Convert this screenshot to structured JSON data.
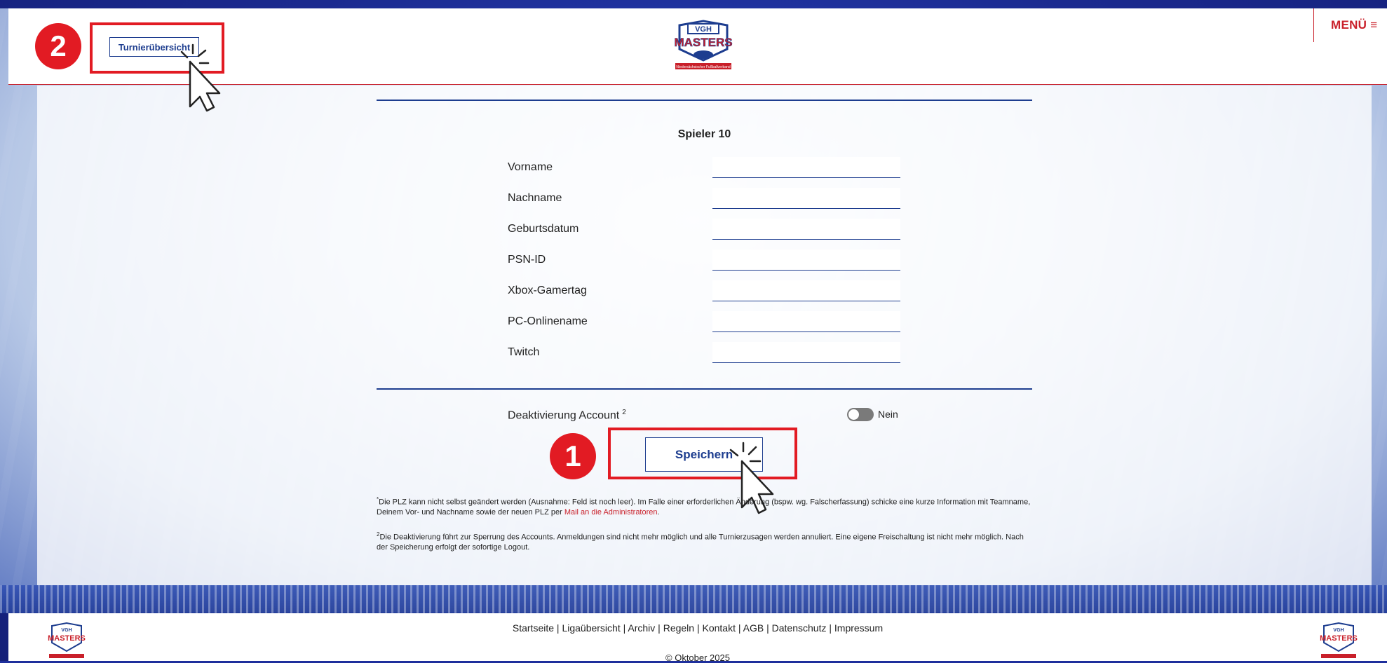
{
  "header": {
    "menu_label": "MENÜ ≡",
    "nav_button_label": "Turnierübersicht",
    "logo_text_top": "VGH",
    "logo_text_main": "MASTERS",
    "logo_subtext": "Niedersächsischer Fußballverband"
  },
  "annotations": {
    "badge_1": "1",
    "badge_2": "2"
  },
  "form": {
    "section_title": "Spieler 10",
    "fields": [
      {
        "label": "Vorname",
        "value": ""
      },
      {
        "label": "Nachname",
        "value": ""
      },
      {
        "label": "Geburtsdatum",
        "value": ""
      },
      {
        "label": "PSN-ID",
        "value": ""
      },
      {
        "label": "Xbox-Gamertag",
        "value": ""
      },
      {
        "label": "PC-Onlinename",
        "value": ""
      },
      {
        "label": "Twitch",
        "value": ""
      }
    ],
    "deactivation_label": "Deaktivierung Account",
    "deactivation_sup": "2",
    "toggle_state": "Nein",
    "save_label": "Speichern"
  },
  "footnotes": {
    "note1_sup": "*",
    "note1_text": "Die PLZ kann nicht selbst geändert werden (Ausnahme: Feld ist noch leer). Im Falle einer erforderlichen Änderung (bspw. wg. Falscherfassung) schicke eine kurze Information mit Teamname, Deinem Vor- und Nachname sowie der neuen PLZ per ",
    "note1_link": "Mail an die Administratoren",
    "note1_end": ".",
    "note2_sup": "2",
    "note2_text": "Die Deaktivierung führt zur Sperrung des Accounts. Anmeldungen sind nicht mehr möglich und alle Turnierzusagen werden annuliert. Eine eigene Freischaltung ist nicht mehr möglich. Nach der Speicherung erfolgt der sofortige Logout."
  },
  "footer": {
    "links": [
      "Startseite",
      "Ligaübersicht",
      "Archiv",
      "Regeln",
      "Kontakt",
      "AGB",
      "Datenschutz",
      "Impressum"
    ],
    "separator": "|",
    "copyright": "© Oktober 2025"
  },
  "colors": {
    "brand_blue": "#1d3d8f",
    "brand_red": "#c9202a",
    "highlight_red": "#e21b23"
  }
}
